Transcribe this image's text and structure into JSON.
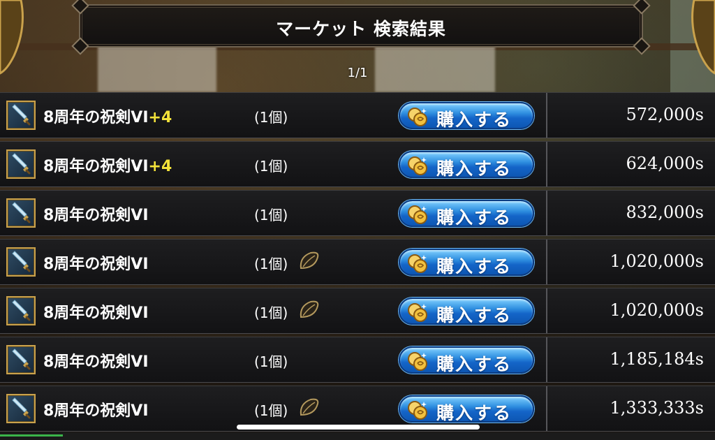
{
  "header": {
    "title": "マーケット 検索結果"
  },
  "pagination": {
    "label": "1/1"
  },
  "listings": [
    {
      "name": "8周年の祝剣VI",
      "plus": "+4",
      "qty": "(1個)",
      "bound": false,
      "buy_label": "購入する",
      "price": "572,000s"
    },
    {
      "name": "8周年の祝剣VI",
      "plus": "+4",
      "qty": "(1個)",
      "bound": false,
      "buy_label": "購入する",
      "price": "624,000s"
    },
    {
      "name": "8周年の祝剣VI",
      "plus": "",
      "qty": "(1個)",
      "bound": false,
      "buy_label": "購入する",
      "price": "832,000s"
    },
    {
      "name": "8周年の祝剣VI",
      "plus": "",
      "qty": "(1個)",
      "bound": true,
      "buy_label": "購入する",
      "price": "1,020,000s"
    },
    {
      "name": "8周年の祝剣VI",
      "plus": "",
      "qty": "(1個)",
      "bound": true,
      "buy_label": "購入する",
      "price": "1,020,000s"
    },
    {
      "name": "8周年の祝剣VI",
      "plus": "",
      "qty": "(1個)",
      "bound": false,
      "buy_label": "購入する",
      "price": "1,185,184s"
    },
    {
      "name": "8周年の祝剣VI",
      "plus": "",
      "qty": "(1個)",
      "bound": true,
      "buy_label": "購入する",
      "price": "1,333,333s"
    }
  ],
  "icons": {
    "item": "sword-icon",
    "bind": "seed-icon",
    "buy": "coin-icon"
  },
  "colors": {
    "plus_text": "#f2e23a",
    "buy_button": "#1465c8",
    "item_frame": "#caa24c"
  }
}
